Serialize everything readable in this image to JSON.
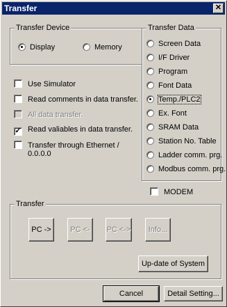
{
  "window": {
    "title": "Transfer",
    "close_glyph": "✕"
  },
  "transfer_device": {
    "title": "Transfer Device",
    "options": [
      {
        "label": "Display",
        "checked": true
      },
      {
        "label": "Memory",
        "checked": false
      }
    ]
  },
  "options": [
    {
      "label": "Use Simulator",
      "checked": false,
      "disabled": false
    },
    {
      "label": "Read comments in data transfer.",
      "checked": false,
      "disabled": false
    },
    {
      "label": "All data transfer.",
      "checked": false,
      "disabled": true
    },
    {
      "label": "Read valiables in data transfer.",
      "checked": true,
      "disabled": false
    },
    {
      "label": "Transfer through Ethernet /",
      "label2": "0.0.0.0",
      "checked": false,
      "disabled": false
    }
  ],
  "transfer_data": {
    "title": "Transfer Data",
    "options": [
      {
        "label": "Screen Data",
        "checked": false
      },
      {
        "label": "I/F Driver",
        "checked": false
      },
      {
        "label": "Program",
        "checked": false
      },
      {
        "label": "Font Data",
        "checked": false
      },
      {
        "label": "Temp./PLC2",
        "checked": true
      },
      {
        "label": "Ex. Font",
        "checked": false
      },
      {
        "label": "SRAM Data",
        "checked": false
      },
      {
        "label": "Station No. Table",
        "checked": false
      },
      {
        "label": "Ladder comm. prg.",
        "checked": false
      },
      {
        "label": "Modbus comm. prg.",
        "checked": false
      }
    ]
  },
  "modem": {
    "label": "MODEM",
    "checked": false
  },
  "transfer": {
    "title": "Transfer",
    "pc_to": "PC ->",
    "pc_from": "PC <-",
    "pc_compare": "PC <->",
    "info": "Info...",
    "update_system": "Up-date of System"
  },
  "footer": {
    "cancel": "Cancel",
    "detail_setting": "Detail Setting..."
  }
}
